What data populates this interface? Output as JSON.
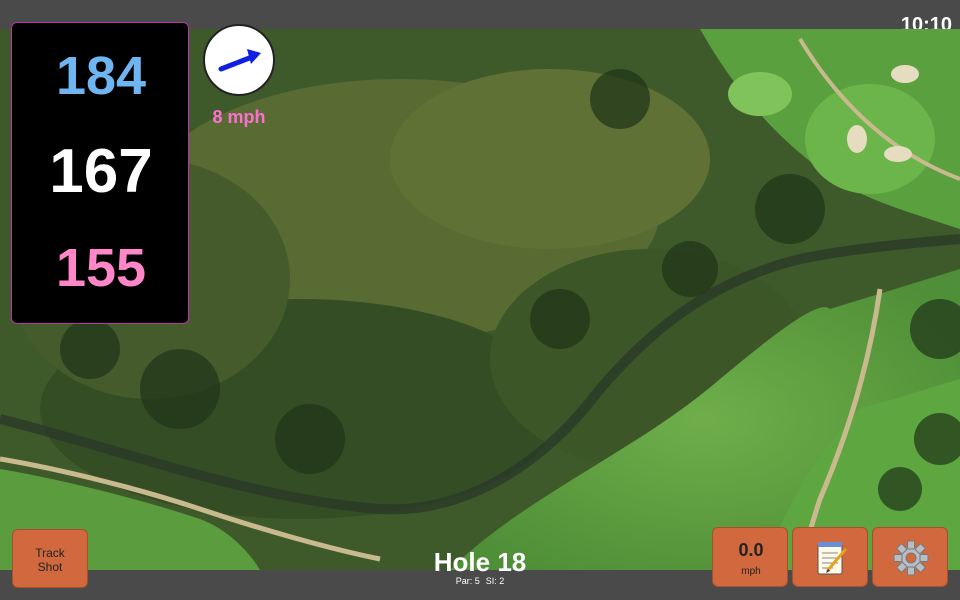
{
  "status": {
    "time": "10:10"
  },
  "yardages": {
    "back": "184",
    "middle": "167",
    "front": "155"
  },
  "wind": {
    "speed": "8 mph",
    "icon": "wind-arrow-icon",
    "direction": "east-northeast"
  },
  "buttons": {
    "track_line1": "Track",
    "track_line2": "Shot",
    "speed_value": "0.0",
    "speed_unit": "mph",
    "notes_icon": "notepad-icon",
    "settings_icon": "gear-icon"
  },
  "hole": {
    "title": "Hole 18",
    "par": "Par: 5",
    "si": "SI: 2"
  },
  "colors": {
    "back": "#6eb5f2",
    "middle": "#ffffff",
    "front": "#ff86c8",
    "wind_speed": "#ff6fd0",
    "button": "#d2693e"
  }
}
